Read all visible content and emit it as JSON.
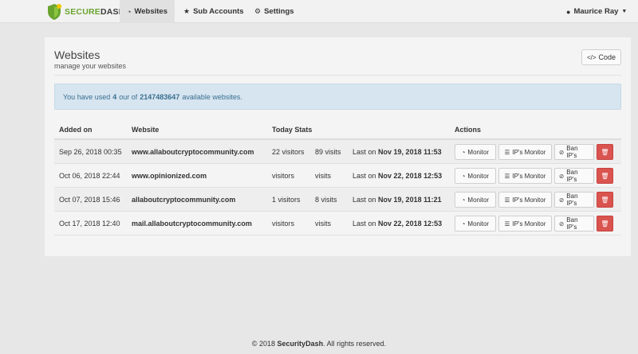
{
  "brand": {
    "part1": "SECURE",
    "part2": "DASH"
  },
  "nav": {
    "items": [
      {
        "label": "Websites",
        "icon": "dashboard-icon",
        "active": true
      },
      {
        "label": "Sub Accounts",
        "icon": "star-icon"
      },
      {
        "label": "Settings",
        "icon": "gears-icon"
      }
    ],
    "user": "Maurice Ray"
  },
  "page": {
    "title": "Websites",
    "subtitle": "manage your websites",
    "code_button": "Code"
  },
  "alert": {
    "prefix": "You have used",
    "used": "4",
    "middle": "our of",
    "total": "2147483647",
    "suffix": "available websites."
  },
  "table": {
    "headers": [
      "Added on",
      "Website",
      "Today Stats",
      "Actions"
    ],
    "rows": [
      {
        "date": "Sep 26, 2018 00:35",
        "site": "www.allaboutcryptocommunity.com",
        "visitors": "22 visitors",
        "visits": "89 visits",
        "last_prefix": "Last on",
        "last": "Nov 19, 2018 11:53"
      },
      {
        "date": "Oct 06, 2018 22:44",
        "site": "www.opinionized.com",
        "visitors": "visitors",
        "visits": "visits",
        "last_prefix": "Last on",
        "last": "Nov 22, 2018 12:53"
      },
      {
        "date": "Oct 07, 2018 15:46",
        "site": "allaboutcryptocommunity.com",
        "visitors": "1 visitors",
        "visits": "8 visits",
        "last_prefix": "Last on",
        "last": "Nov 19, 2018 11:21"
      },
      {
        "date": "Oct 17, 2018 12:40",
        "site": "mail.allaboutcryptocommunity.com",
        "visitors": "visitors",
        "visits": "visits",
        "last_prefix": "Last on",
        "last": "Nov 22, 2018 12:53"
      }
    ],
    "actions": {
      "monitor": "Monitor",
      "ip_monitor": "IP's Monitor",
      "ban": "Ban IP's"
    }
  },
  "footer": {
    "prefix": "© 2018",
    "brand": "SecurityDash",
    "suffix": ". All rights reserved."
  }
}
